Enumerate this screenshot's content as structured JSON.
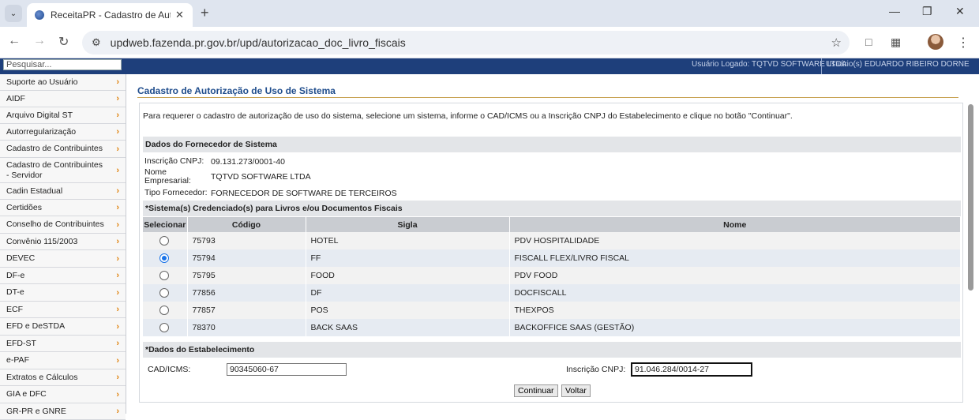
{
  "browser": {
    "tab_title": "ReceitaPR - Cadastro de Autori:",
    "url": "updweb.fazenda.pr.gov.br/upd/autorizacao_doc_livro_fiscais"
  },
  "header": {
    "search_placeholder": "Pesquisar...",
    "user_info": "Usuário Logado: TQTVD SOFTWARE LTDA",
    "session_info": "Usuário(s) EDUARDO RIBEIRO DORNE"
  },
  "sidebar": {
    "items": [
      {
        "label": "Suporte ao Usuário"
      },
      {
        "label": "AIDF"
      },
      {
        "label": "Arquivo Digital ST"
      },
      {
        "label": "Autorregularização"
      },
      {
        "label": "Cadastro de Contribuintes"
      },
      {
        "label": "Cadastro de Contribuintes - Servidor"
      },
      {
        "label": "Cadin Estadual"
      },
      {
        "label": "Certidões"
      },
      {
        "label": "Conselho de Contribuintes"
      },
      {
        "label": "Convênio 115/2003"
      },
      {
        "label": "DEVEC"
      },
      {
        "label": "DF-e"
      },
      {
        "label": "DT-e"
      },
      {
        "label": "ECF"
      },
      {
        "label": "EFD e DeSTDA"
      },
      {
        "label": "EFD-ST"
      },
      {
        "label": "e-PAF"
      },
      {
        "label": "Extratos e Cálculos"
      },
      {
        "label": "GIA e DFC"
      },
      {
        "label": "GR-PR e GNRE"
      }
    ]
  },
  "main": {
    "title": "Cadastro de Autorização de Uso de Sistema",
    "intro": "Para requerer o cadastro de autorização de uso do sistema, selecione um sistema, informe o CAD/ICMS ou a Inscrição CNPJ do Estabelecimento e clique no botão \"Continuar\".",
    "supplier": {
      "section_title": "Dados do Fornecedor de Sistema",
      "cnpj_label": "Inscrição CNPJ:",
      "cnpj_value": "09.131.273/0001-40",
      "name_label_1": "Nome",
      "name_label_2": "Empresarial:",
      "name_value": "TQTVD SOFTWARE LTDA",
      "type_label": "Tipo Fornecedor:",
      "type_value": "FORNECEDOR DE SOFTWARE DE TERCEIROS"
    },
    "systems": {
      "section_title": "*Sistema(s) Credenciado(s) para Livros e/ou Documentos Fiscais",
      "columns": [
        "Selecionar",
        "Código",
        "Sigla",
        "Nome"
      ],
      "rows": [
        {
          "codigo": "75793",
          "sigla": "HOTEL",
          "nome": "PDV HOSPITALIDADE",
          "selected": false
        },
        {
          "codigo": "75794",
          "sigla": "FF",
          "nome": "FISCALL FLEX/LIVRO FISCAL",
          "selected": true
        },
        {
          "codigo": "75795",
          "sigla": "FOOD",
          "nome": "PDV FOOD",
          "selected": false
        },
        {
          "codigo": "77856",
          "sigla": "DF",
          "nome": "DOCFISCALL",
          "selected": false
        },
        {
          "codigo": "77857",
          "sigla": "POS",
          "nome": "THEXPOS",
          "selected": false
        },
        {
          "codigo": "78370",
          "sigla": "BACK SAAS",
          "nome": "BACKOFFICE SAAS (GESTÃO)",
          "selected": false
        }
      ]
    },
    "establishment": {
      "section_title": "*Dados do Estabelecimento",
      "cad_label": "CAD/ICMS:",
      "cad_value": "90345060-67",
      "cnpj_label": "Inscrição CNPJ:",
      "cnpj_value": "91.046.284/0014-27"
    },
    "buttons": {
      "continue": "Continuar",
      "back": "Voltar"
    }
  }
}
